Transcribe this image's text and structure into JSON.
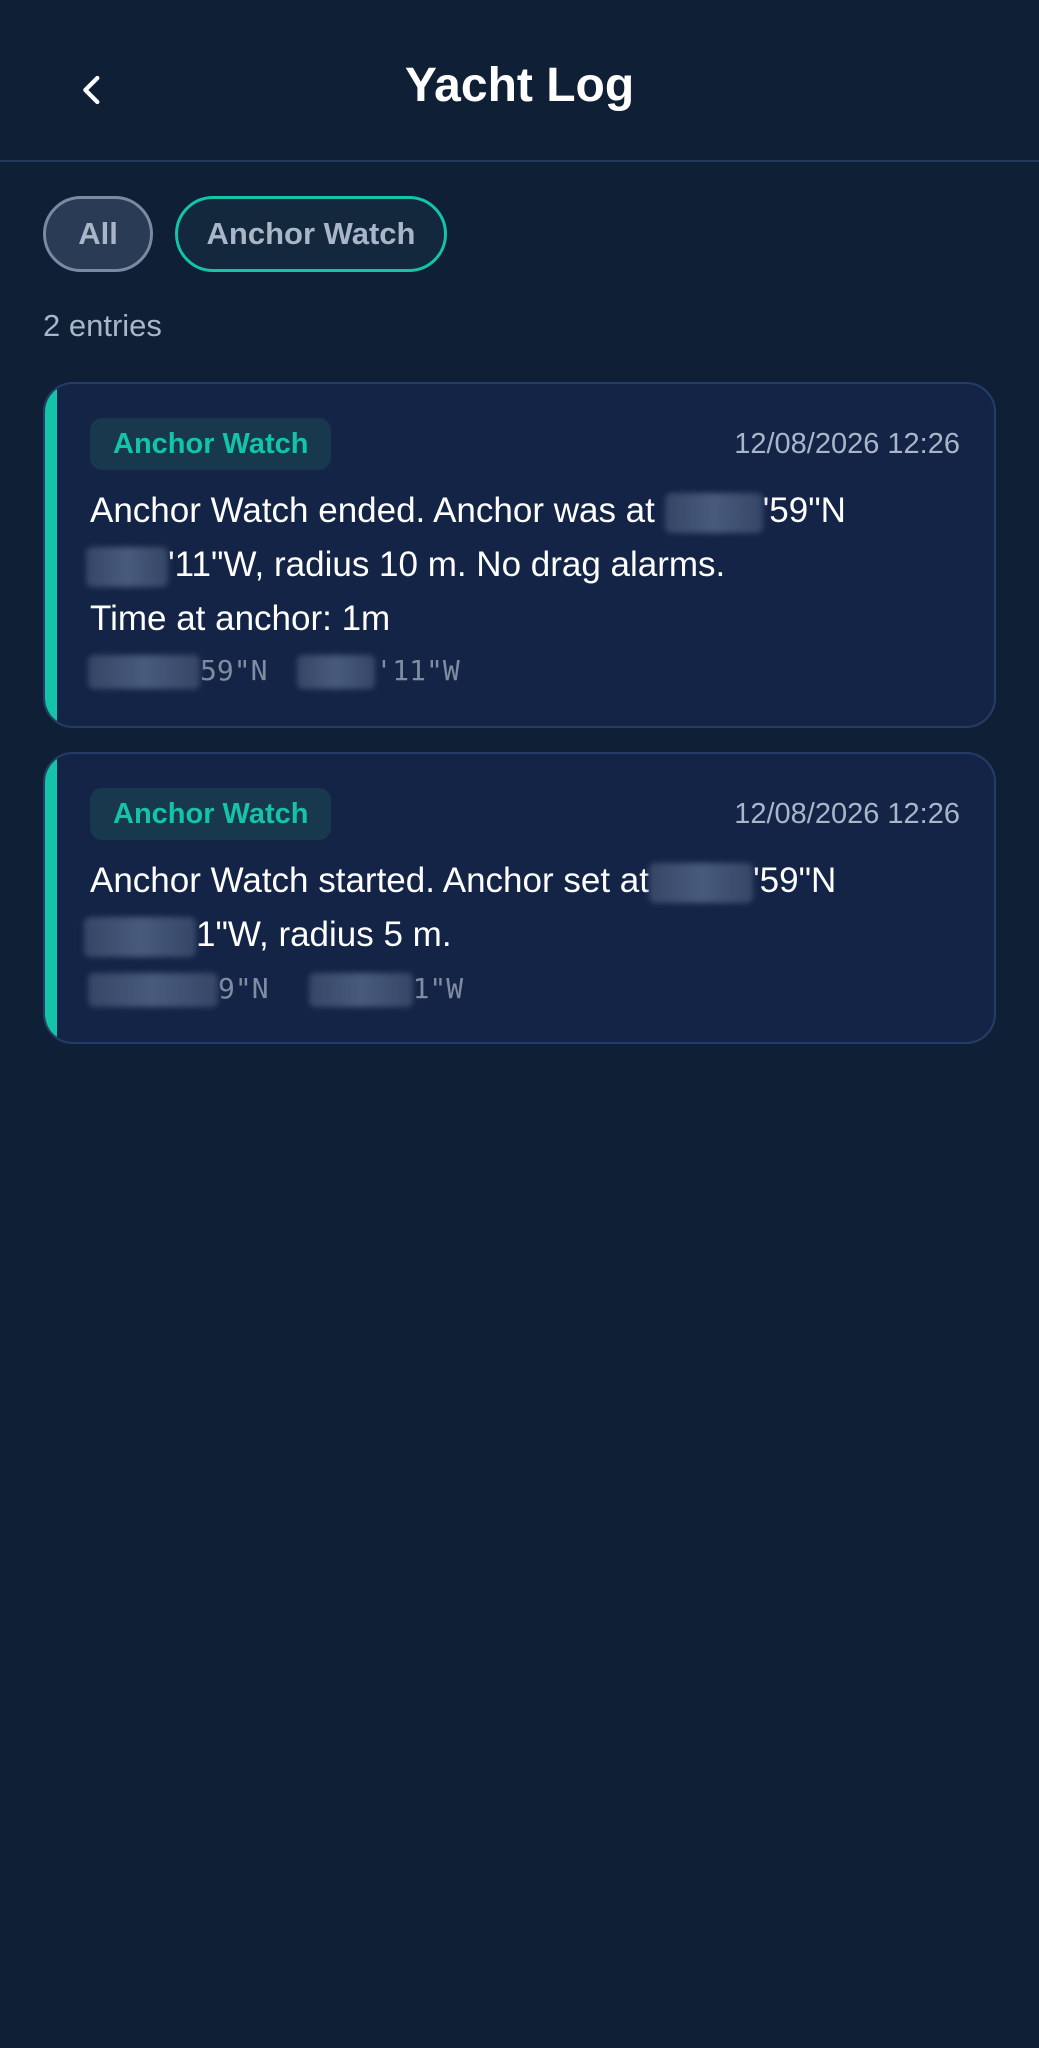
{
  "header": {
    "title": "Yacht Log",
    "back_icon": "chevron-left-icon"
  },
  "filters": {
    "all_label": "All",
    "anchor_label": "Anchor Watch",
    "selected": "Anchor Watch"
  },
  "entry_count": "2 entries",
  "colors": {
    "background": "#0f1f35",
    "card": "#142447",
    "accent": "#14c3a8",
    "muted_text": "#a9b6c7"
  },
  "entries": [
    {
      "tag": "Anchor Watch",
      "timestamp": "12/08/2026 12:26",
      "msg_p1": "Anchor Watch ended. Anchor was at ",
      "msg_p2": "'59\"N",
      "msg_p3": "'11\"W, radius 10 m. No drag alarms.",
      "msg_p4": "Time at anchor: 1m",
      "lat_tail": "59\"N",
      "lon_tail": "'11\"W"
    },
    {
      "tag": "Anchor Watch",
      "timestamp": "12/08/2026 12:26",
      "msg_p1": "Anchor Watch started. Anchor set at",
      "msg_p2": "'59\"N",
      "msg_p3": "1\"W, radius 5 m.",
      "lat_tail": "9\"N",
      "lon_tail": "1\"W"
    }
  ]
}
